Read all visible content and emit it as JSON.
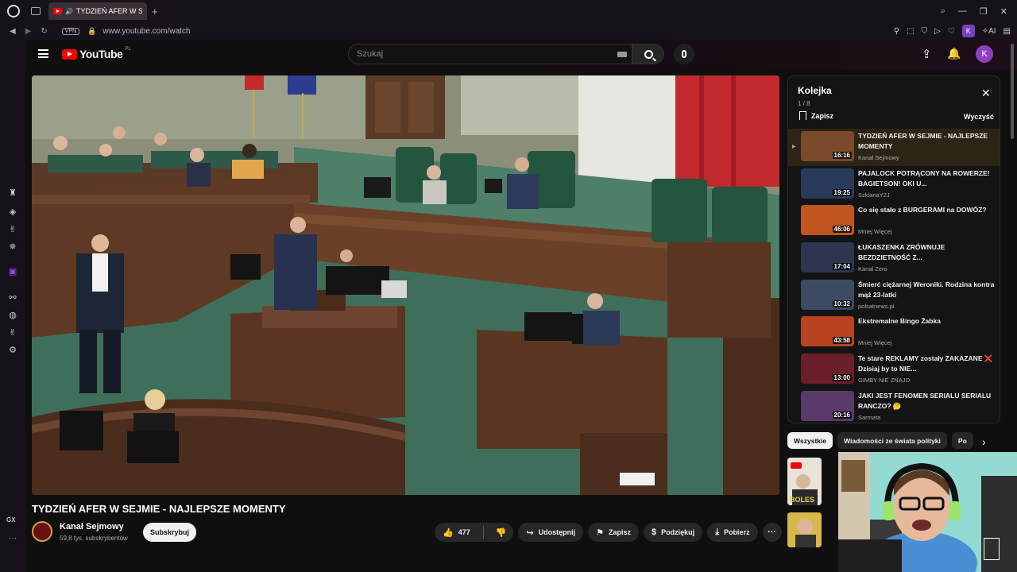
{
  "browser": {
    "tab_title": "TYDZIEŃ AFER W SEJMIE",
    "tab_add": "+",
    "url": "www.youtube.com/watch",
    "vpn_label": "VPN",
    "ai_label": "AI",
    "profile_initial": "K",
    "rail_gx": "GX",
    "rail_more": "···"
  },
  "header": {
    "logo_text": "YouTube",
    "country_code": "PL",
    "search_placeholder": "Szukaj",
    "avatar_initial": "K"
  },
  "video": {
    "title": "TYDZIEŃ AFER W SEJMIE - NAJLEPSZE MOMENTY",
    "channel_name": "Kanał Sejmowy",
    "channel_subs": "59,8 tys. subskrybentów",
    "subscribe_label": "Subskrybuj",
    "likes": "477",
    "share_label": "Udostępnij",
    "save_label": "Zapisz",
    "thanks_label": "Podziękuj",
    "download_label": "Pobierz"
  },
  "queue": {
    "title": "Kolejka",
    "position": "1 / 8",
    "save_label": "Zapisz",
    "clear_label": "Wyczyść",
    "items": [
      {
        "title": "TYDZIEŃ AFER W SEJMIE - NAJLEPSZE MOMENTY",
        "channel": "Kanał Sejmowy",
        "duration": "16:16",
        "thumb_color": "#7a4a2a",
        "active": true
      },
      {
        "title": "PAJALOCK POTRĄCONY NA ROWERZE! BAGIETSON! OKI U...",
        "channel": "SzklanaY2J",
        "duration": "19:25",
        "thumb_color": "#2a3a5a",
        "active": false
      },
      {
        "title": "Co się stało z BURGERAMI na DOWÓZ?",
        "channel": "Mniej Więcej",
        "duration": "46:06",
        "thumb_color": "#c0551f",
        "active": false
      },
      {
        "title": "ŁUKASZENKA ZRÓWNUJE BEZDZIETNOŚĆ Z...",
        "channel": "Kanał Zero",
        "duration": "17:04",
        "thumb_color": "#2e3550",
        "active": false
      },
      {
        "title": "Śmierć ciężarnej Weroniki. Rodzina kontra mąż 23-latki",
        "channel": "polsatnews.pl",
        "duration": "10:32",
        "thumb_color": "#3d4a63",
        "active": false
      },
      {
        "title": "Ekstremalne Bingo Żabka",
        "channel": "Mniej Więcej",
        "duration": "43:58",
        "thumb_color": "#b8431e",
        "active": false
      },
      {
        "title": "Te stare REKLAMY zostały ZAKAZANE ❌ Dzisiaj by to NIE...",
        "channel": "GIMBY NIE ZNAJO",
        "duration": "13:00",
        "thumb_color": "#6a1f2a",
        "active": false
      },
      {
        "title": "JAKI JEST FENOMEN SERIALU SERIALU RANCZO? 🤔",
        "channel": "Sarmata",
        "duration": "20:16",
        "thumb_color": "#5a3a6a",
        "active": false
      }
    ]
  },
  "chips": [
    "Wszystkie",
    "Wiadomości ze świata polityki",
    "Po"
  ],
  "recommendations": [
    {
      "label": "BOLES"
    },
    {
      "label": ""
    }
  ]
}
